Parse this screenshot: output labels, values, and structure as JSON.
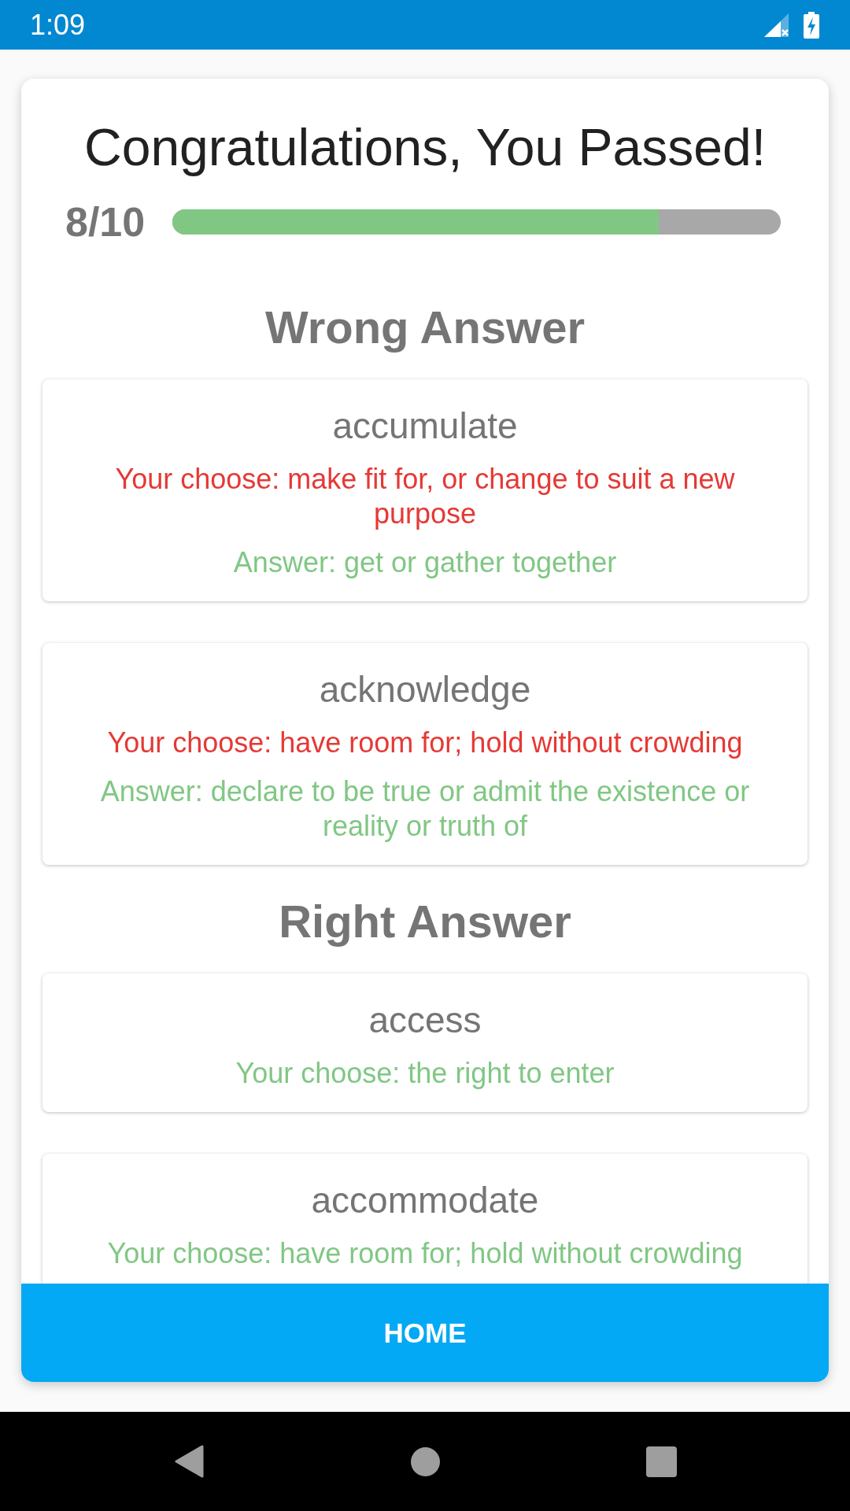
{
  "status_bar": {
    "time": "1:09"
  },
  "result": {
    "title": "Congratulations, You Passed!",
    "score": "8/10",
    "level": 0.8
  },
  "sections": [
    {
      "heading": "Wrong Answer",
      "items": [
        {
          "word": "accumulate",
          "lines": [
            {
              "kind": "wrong",
              "text": "Your choose: make fit for, or change to suit a new purpose"
            },
            {
              "kind": "correct",
              "text": "Answer: get or gather together"
            }
          ]
        },
        {
          "word": "acknowledge",
          "lines": [
            {
              "kind": "wrong",
              "text": "Your choose: have room for; hold without crowding"
            },
            {
              "kind": "correct",
              "text": "Answer: declare to be true or admit the existence or reality or truth of"
            }
          ]
        }
      ]
    },
    {
      "heading": "Right Answer",
      "items": [
        {
          "word": "access",
          "lines": [
            {
              "kind": "correct",
              "text": "Your choose: the right to enter"
            }
          ]
        },
        {
          "word": "accommodate",
          "lines": [
            {
              "kind": "correct",
              "text": "Your choose: have room for; hold without crowding"
            }
          ]
        }
      ]
    }
  ],
  "home_button": {
    "label": "HOME"
  }
}
